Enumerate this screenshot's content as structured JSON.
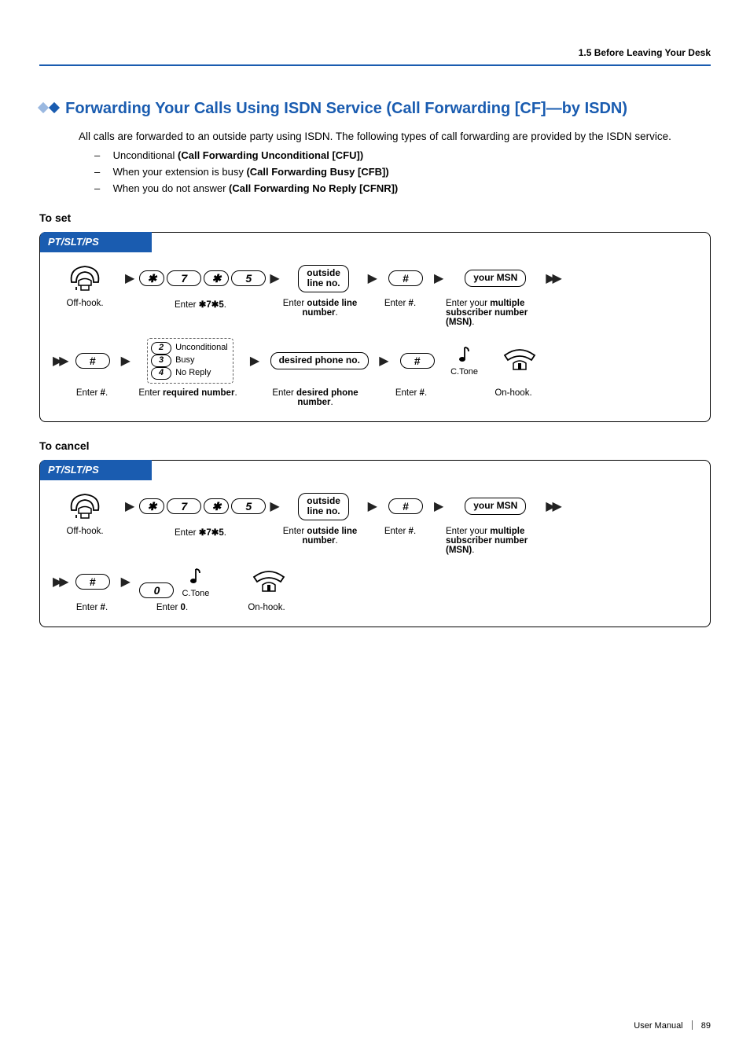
{
  "header": {
    "breadcrumb": "1.5 Before Leaving Your Desk"
  },
  "section": {
    "title": "Forwarding Your Calls Using ISDN Service (Call Forwarding [CF]—by ISDN)",
    "intro": "All calls are forwarded to an outside party using ISDN. The following types of call forwarding are provided by the ISDN service.",
    "bullets": [
      {
        "prefix": "Unconditional ",
        "bold": "(Call Forwarding Unconditional [CFU])"
      },
      {
        "prefix": "When your extension is busy ",
        "bold": "(Call Forwarding Busy [CFB])"
      },
      {
        "prefix": "When you do not answer ",
        "bold": "(Call Forwarding No Reply [CFNR])"
      }
    ]
  },
  "headings": {
    "to_set": "To set",
    "to_cancel": "To cancel"
  },
  "diagram": {
    "tab": "PT/SLT/PS",
    "keys": {
      "star": "✱",
      "hash": "#",
      "seven": "7",
      "five": "5",
      "zero": "0",
      "two": "2",
      "three": "3",
      "four": "4"
    },
    "bubbles": {
      "outside_line": "outside\nline no.",
      "your_msn": "your MSN",
      "desired_phone": "desired phone no."
    },
    "options": {
      "unconditional": "Unconditional",
      "busy": "Busy",
      "no_reply": "No Reply"
    },
    "captions": {
      "off_hook": "Off-hook.",
      "enter_star7star5_pre": "Enter ",
      "enter_star7star5_code": "✱7✱5",
      "enter_star7star5_post": ".",
      "enter_outside_pre": "Enter ",
      "enter_outside_bold": "outside line number",
      "enter_outside_post": ".",
      "enter_hash_pre": "Enter ",
      "enter_hash_bold": "#",
      "enter_hash_post": ".",
      "enter_msn_pre": "Enter your ",
      "enter_msn_bold": "multiple subscriber number (MSN)",
      "enter_msn_post": ".",
      "enter_required_pre": "Enter ",
      "enter_required_bold": "required number",
      "enter_required_post": ".",
      "enter_desired_pre": "Enter ",
      "enter_desired_bold": "desired phone number",
      "enter_desired_post": ".",
      "ctone": "C.Tone",
      "on_hook": "On-hook.",
      "enter_zero_pre": "Enter ",
      "enter_zero_bold": "0",
      "enter_zero_post": "."
    }
  },
  "footer": {
    "label": "User Manual",
    "page": "89"
  }
}
